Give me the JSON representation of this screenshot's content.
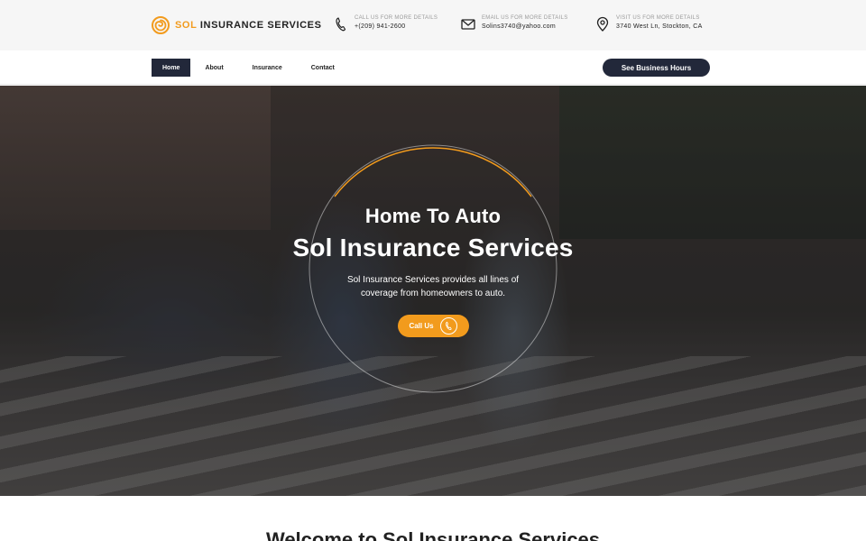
{
  "brand": {
    "name_accent": "SOL",
    "name_rest": "INSURANCE SERVICES",
    "accent_color": "#f29b1d",
    "logo_icon": "spiral-sun-icon"
  },
  "contact": {
    "phone": {
      "caption": "CALL US FOR MORE DETAILS",
      "value": "+(209) 941-2600",
      "icon": "phone-icon"
    },
    "email": {
      "caption": "EMAIL US FOR MORE DETAILS",
      "value": "Solins3740@yahoo.com",
      "icon": "envelope-icon"
    },
    "address": {
      "caption": "VISIT US FOR MORE DETAILS",
      "value": "3740 West Ln, Stockton, CA",
      "icon": "map-pin-icon"
    }
  },
  "nav": {
    "items": [
      {
        "label": "Home",
        "active": true
      },
      {
        "label": "About",
        "active": false
      },
      {
        "label": "Insurance",
        "active": false
      },
      {
        "label": "Contact",
        "active": false
      }
    ],
    "hours_button": "See Business Hours",
    "dark_color": "#22283a"
  },
  "hero": {
    "kicker": "Home To Auto",
    "title": "Sol Insurance Services",
    "description": "Sol Insurance Services provides all lines of coverage from homeowners to auto.",
    "cta_label": "Call Us",
    "cta_icon": "phone-icon"
  },
  "welcome": {
    "heading": "Welcome to Sol Insurance Services"
  }
}
